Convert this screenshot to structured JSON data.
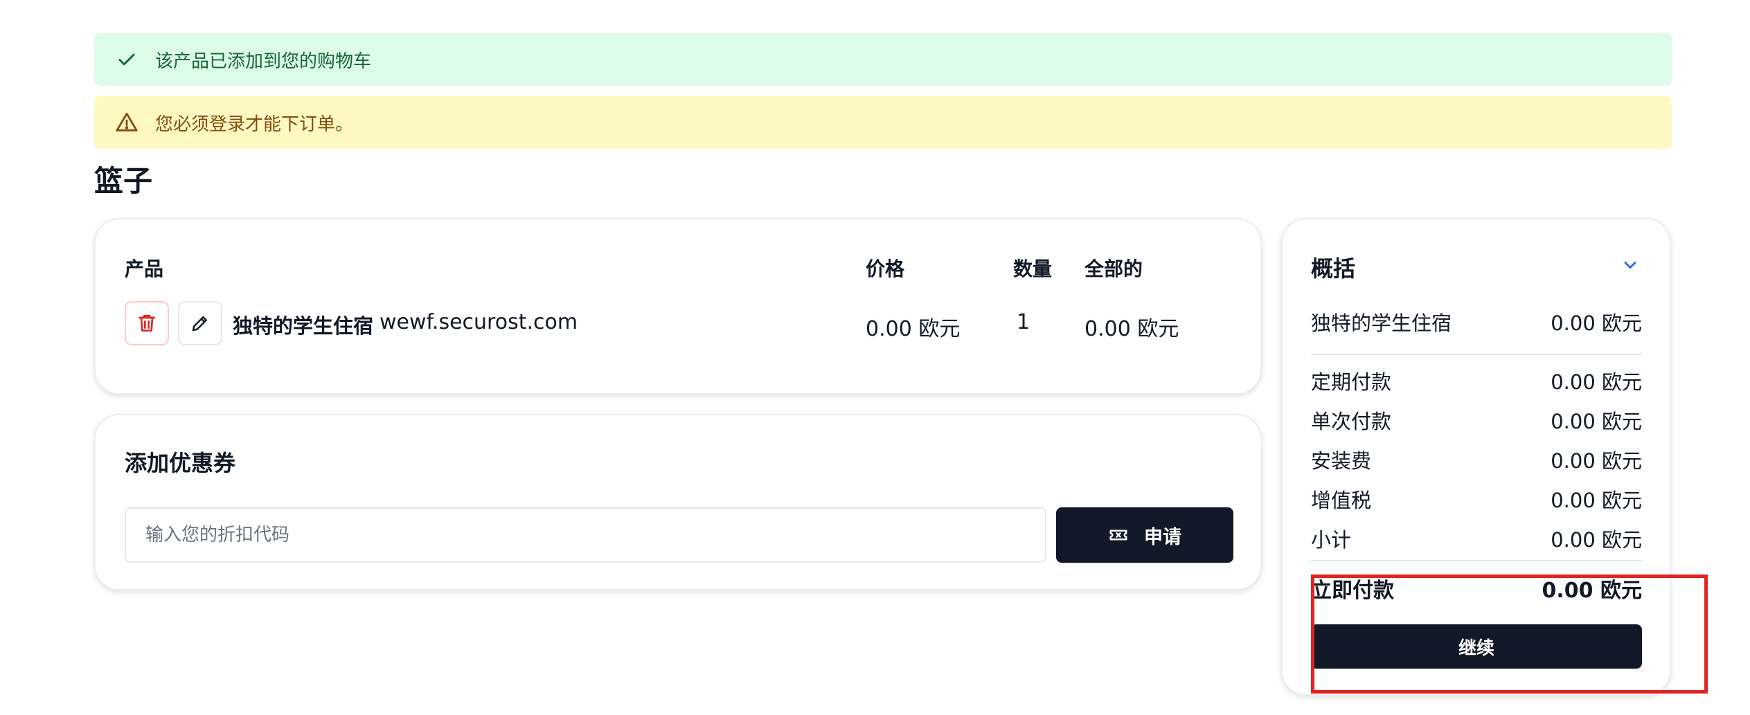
{
  "alerts": {
    "success": "该产品已添加到您的购物车",
    "warning": "您必须登录才能下订单。"
  },
  "page": {
    "title": "篮子"
  },
  "basket": {
    "headers": {
      "product": "产品",
      "price": "价格",
      "quantity": "数量",
      "total": "全部的"
    },
    "items": [
      {
        "name": "独特的学生住宿",
        "domain": "wewf.securost.com",
        "price": "0.00 欧元",
        "quantity": "1",
        "total": "0.00 欧元"
      }
    ]
  },
  "coupon": {
    "title": "添加优惠券",
    "placeholder": "输入您的折扣代码",
    "value": "",
    "apply_label": "申请"
  },
  "summary": {
    "title": "概括",
    "item": {
      "label": "独特的学生住宿",
      "value": "0.00 欧元"
    },
    "rows": [
      {
        "label": "定期付款",
        "value": "0.00 欧元"
      },
      {
        "label": "单次付款",
        "value": "0.00 欧元"
      },
      {
        "label": "安装费",
        "value": "0.00 欧元"
      },
      {
        "label": "增值税",
        "value": "0.00 欧元"
      },
      {
        "label": "小计",
        "value": "0.00 欧元"
      }
    ],
    "total": {
      "label": "立即付款",
      "value": "0.00 欧元"
    },
    "continue_label": "继续"
  },
  "colors": {
    "success_bg": "#dcfce7",
    "warning_bg": "#fef9c3",
    "primary": "#111827",
    "danger": "#dc2626",
    "highlight": "#e02424"
  },
  "icons": {
    "success": "check-icon",
    "warning": "warning-triangle-icon",
    "delete": "trash-icon",
    "edit": "pencil-icon",
    "apply": "ticket-icon",
    "summary_toggle": "chevron-down-icon"
  }
}
